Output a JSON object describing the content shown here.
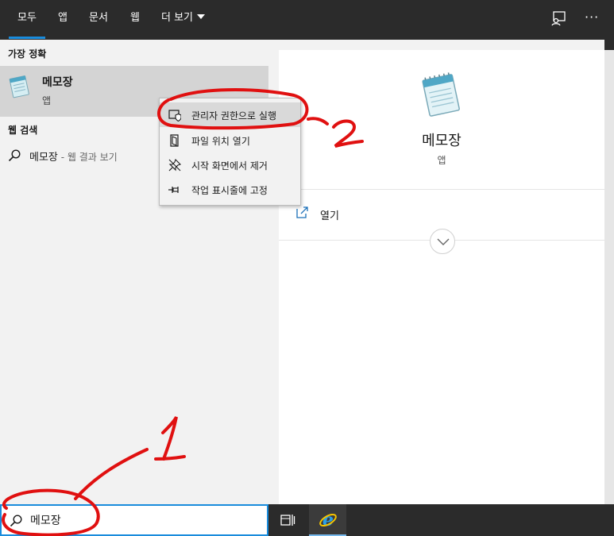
{
  "top_bar": {
    "tabs": [
      {
        "label": "모두"
      },
      {
        "label": "앱"
      },
      {
        "label": "문서"
      },
      {
        "label": "웹"
      },
      {
        "label": "더 보기"
      }
    ],
    "icons": [
      "feedback-icon",
      "more-options-icon"
    ],
    "more_glyph": "···"
  },
  "left_pane": {
    "best_match_heading": "가장 정확",
    "best_match": {
      "name": "메모장",
      "type": "앱",
      "icon": "notepad-icon"
    },
    "web_search_heading": "웹 검색",
    "web_result": {
      "query": "메모장",
      "suffix": " - 웹 결과 보기",
      "icon": "search-icon"
    }
  },
  "context_menu": {
    "items": [
      {
        "label": "관리자 권한으로 실행",
        "icon": "shield-icon"
      },
      {
        "label": "파일 위치 열기",
        "icon": "folder-icon"
      },
      {
        "label": "시작 화면에서 제거",
        "icon": "unpin-icon"
      },
      {
        "label": "작업 표시줄에 고정",
        "icon": "pin-icon"
      }
    ]
  },
  "right_pane": {
    "title": "메모장",
    "subtitle": "앱",
    "icon": "notepad-icon",
    "actions": [
      {
        "label": "열기",
        "icon": "open-icon"
      }
    ],
    "expand_icon": "chevron-down-icon"
  },
  "taskbar": {
    "search_value": "메모장",
    "search_icon": "search-icon",
    "apps": [
      {
        "icon": "task-view-icon"
      },
      {
        "icon": "internet-explorer-icon"
      }
    ]
  },
  "annotations": {
    "labels": [
      "1",
      "2"
    ],
    "color": "#e01010"
  },
  "colors": {
    "accent": "#1a8cdc",
    "topbar": "#2b2b2b",
    "selection": "#d4d4d4"
  }
}
